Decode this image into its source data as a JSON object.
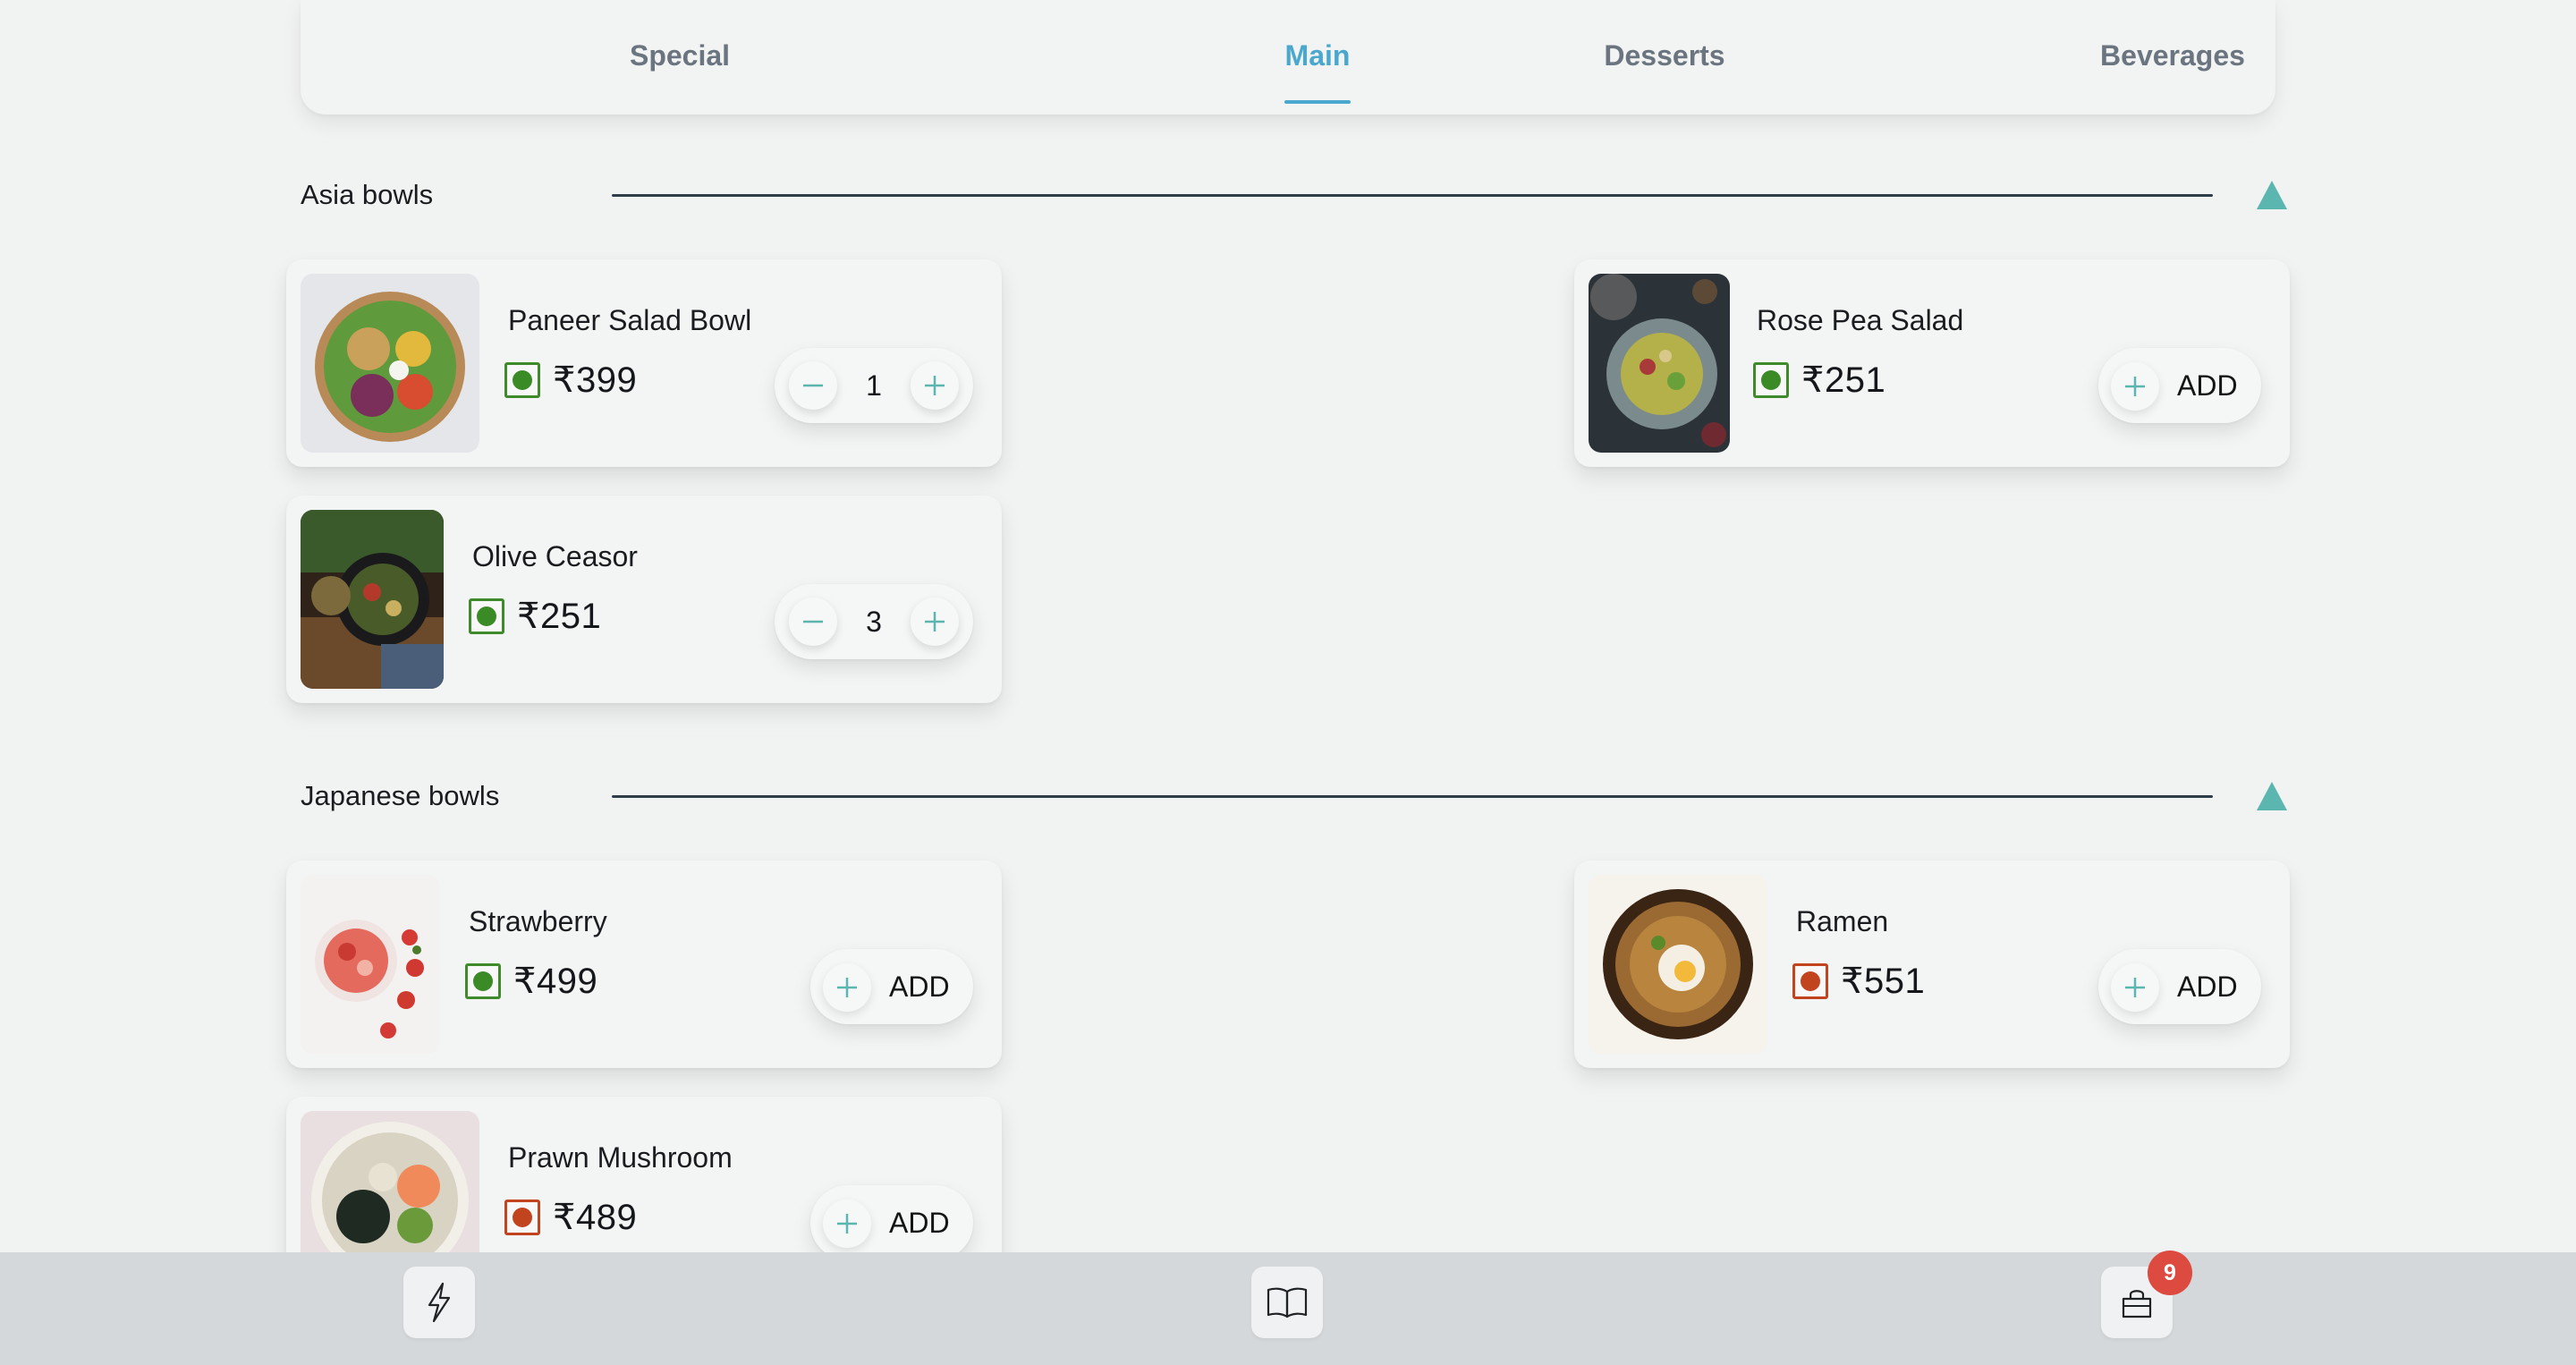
{
  "tabs": [
    {
      "label": "Special",
      "active": false
    },
    {
      "label": "Main",
      "active": true
    },
    {
      "label": "Desserts",
      "active": false
    },
    {
      "label": "Beverages",
      "active": false
    }
  ],
  "colors": {
    "accent": "#4aa8cf",
    "teal": "#5bb6b0",
    "veg": "#3a8a26",
    "nonveg": "#c2441e",
    "badge": "#dc4a40"
  },
  "sections": [
    {
      "title": "Asia bowls",
      "collapse_icon": "triangle-up-icon",
      "items": [
        {
          "name": "Paneer Salad Bowl",
          "price": "₹399",
          "type": "veg",
          "action": "stepper",
          "qty": "1"
        },
        {
          "name": "Rose Pea Salad",
          "price": "₹251",
          "type": "veg",
          "action": "add",
          "add_label": "ADD"
        },
        {
          "name": "Olive Ceasor",
          "price": "₹251",
          "type": "veg",
          "action": "stepper",
          "qty": "3"
        }
      ]
    },
    {
      "title": "Japanese bowls",
      "collapse_icon": "triangle-up-icon",
      "items": [
        {
          "name": "Strawberry",
          "price": "₹499",
          "type": "veg",
          "action": "add",
          "add_label": "ADD"
        },
        {
          "name": "Ramen",
          "price": "₹551",
          "type": "nonveg",
          "action": "add",
          "add_label": "ADD"
        },
        {
          "name": "Prawn Mushroom",
          "price": "₹489",
          "type": "nonveg",
          "action": "add",
          "add_label": "ADD"
        }
      ]
    }
  ],
  "bottom_nav": {
    "items": [
      {
        "icon": "lightning-icon"
      },
      {
        "icon": "book-icon"
      },
      {
        "icon": "shopping-bag-icon",
        "badge": "9"
      }
    ]
  }
}
